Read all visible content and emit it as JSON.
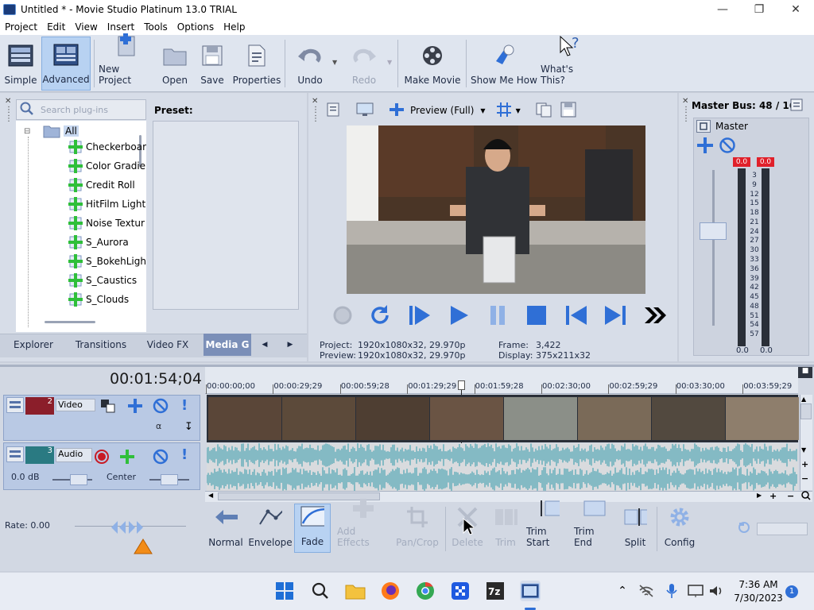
{
  "window": {
    "title": "Untitled * - Movie Studio Platinum 13.0 TRIAL",
    "minimize_icon": "minimize-icon",
    "maximize_icon": "maximize-icon",
    "close_icon": "close-icon"
  },
  "menu": [
    "Project",
    "Edit",
    "View",
    "Insert",
    "Tools",
    "Options",
    "Help"
  ],
  "toolbar": {
    "simple": "Simple",
    "advanced": "Advanced",
    "new_project": "New Project",
    "open": "Open",
    "save": "Save",
    "properties": "Properties",
    "undo": "Undo",
    "redo": "Redo",
    "make_movie": "Make Movie",
    "show_me_how": "Show Me How",
    "whats_this": "What's This?"
  },
  "plugins": {
    "search_placeholder": "Search plug-ins",
    "preset_label": "Preset:",
    "root": "All",
    "items": [
      "Checkerboar",
      "Color Gradier",
      "Credit Roll",
      "HitFilm Light I",
      "Noise Textur",
      "S_Aurora",
      "S_BokehLight",
      "S_Caustics",
      "S_Clouds"
    ]
  },
  "bottom_tabs": [
    "Explorer",
    "Transitions",
    "Video FX",
    "Media G"
  ],
  "preview": {
    "mode": "Preview (Full)",
    "project_label": "Project:",
    "project_value": "1920x1080x32, 29.970p",
    "preview_label": "Preview:",
    "preview_value": "1920x1080x32, 29.970p",
    "frame_label": "Frame:",
    "frame_value": "3,422",
    "display_label": "Display:",
    "display_value": "375x211x32"
  },
  "master": {
    "title": "Master Bus: 48 / 16",
    "name": "Master",
    "peak_left": "0.0",
    "peak_right": "0.0",
    "scale": [
      "3",
      "9",
      "12",
      "15",
      "18",
      "21",
      "24",
      "27",
      "30",
      "33",
      "36",
      "39",
      "42",
      "45",
      "48",
      "51",
      "54",
      "57"
    ],
    "bottom_left": "0.0",
    "bottom_right": "0.0"
  },
  "timeline": {
    "timecode": "00:01:54;04",
    "ruler": [
      "00:00:00;00",
      "00:00:29;29",
      "00:00:59;28",
      "00:01:29;29",
      "00:01:59;28",
      "00:02:30;00",
      "00:02:59;29",
      "00:03:30;00",
      "00:03:59;29"
    ],
    "video_track": {
      "number": "2",
      "name": "Video"
    },
    "audio_track": {
      "number": "3",
      "name": "Audio",
      "volume": "0.0 dB",
      "pan": "Center"
    },
    "rate": "Rate: 0.00"
  },
  "edit_tools": {
    "normal": "Normal",
    "envelope": "Envelope",
    "fade": "Fade",
    "add_effects": "Add Effects",
    "pan_crop": "Pan/Crop",
    "delete": "Delete",
    "trim": "Trim",
    "trim_start": "Trim Start",
    "trim_end": "Trim End",
    "split": "Split",
    "config": "Config"
  },
  "taskbar": {
    "time": "7:36 AM",
    "date": "7/30/2023",
    "notifications": "1"
  },
  "colors": {
    "accent": "#2f6fd6",
    "meter_red": "#e0202a",
    "waveform": "#6fb2bd"
  }
}
